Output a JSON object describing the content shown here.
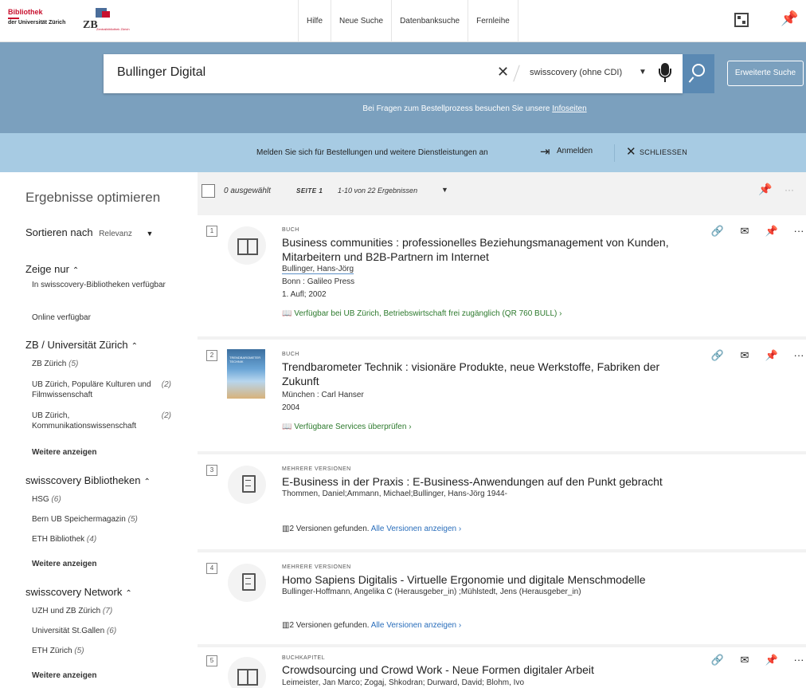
{
  "header": {
    "logo1_line1": "Bibliothek",
    "logo1_line2": "der Universität Zürich",
    "logo2_text": "ZB",
    "logo2_small": "Zentralbibliothek Zürich",
    "nav": [
      "Hilfe",
      "Neue Suche",
      "Datenbanksuche",
      "Fernleihe"
    ]
  },
  "search": {
    "query": "Bullinger Digital",
    "scope": "swisscovery (ohne CDI)",
    "advanced_label": "Erweiterte Suche",
    "info_prefix": "Bei Fragen zum Bestellprozess besuchen Sie unsere",
    "info_link": "Infoseiten"
  },
  "login": {
    "message": "Melden Sie sich für Bestellungen und weitere Dienstleistungen an",
    "signin_label": "Anmelden",
    "close_label": "SCHLIESSEN"
  },
  "sidebar": {
    "title": "Ergebnisse optimieren",
    "sort_label": "Sortieren nach",
    "sort_value": "Relevanz",
    "show_only": {
      "heading": "Zeige nur",
      "items": [
        "In swisscovery-Bibliotheken verfügbar",
        "Online verfügbar"
      ]
    },
    "zb": {
      "heading": "ZB / Universität Zürich",
      "items": [
        {
          "label": "ZB Zürich",
          "count": "(5)"
        },
        {
          "label": "UB Zürich, Populäre Kulturen und Filmwissenschaft",
          "count": "(2)"
        },
        {
          "label": "UB Zürich, Kommunikationswissenschaft",
          "count": "(2)"
        }
      ],
      "more": "Weitere anzeigen"
    },
    "libs": {
      "heading": "swisscovery Bibliotheken",
      "items": [
        {
          "label": "HSG",
          "count": "(6)"
        },
        {
          "label": "Bern UB Speichermagazin",
          "count": "(5)"
        },
        {
          "label": "ETH Bibliothek",
          "count": "(4)"
        }
      ],
      "more": "Weitere anzeigen"
    },
    "network": {
      "heading": "swisscovery Network",
      "items": [
        {
          "label": "UZH und ZB Zürich",
          "count": "(7)"
        },
        {
          "label": "Universität St.Gallen",
          "count": "(6)"
        },
        {
          "label": "ETH Zürich",
          "count": "(5)"
        }
      ],
      "more": "Weitere anzeigen"
    }
  },
  "results_bar": {
    "selected": "0 ausgewählt",
    "page": "SEITE 1",
    "range": "1-10 von 22 Ergebnissen"
  },
  "results": [
    {
      "num": "1",
      "type": "BUCH",
      "title": "Business communities : professionelles Beziehungsmanagement von Kunden, Mitarbeitern und B2B-Partnern im Internet",
      "author": "Bullinger, Hans-Jörg",
      "publisher": "Bonn : Galileo Press",
      "edition": "1. Aufl; 2002",
      "avail": "Verfügbar bei UB Zürich, Betriebswirtschaft  frei zugänglich (QR 760 BULL)  ›"
    },
    {
      "num": "2",
      "type": "BUCH",
      "title": "Trendbarometer Technik : visionäre Produkte, neue Werkstoffe, Fabriken der Zukunft",
      "publisher": "München : Carl Hanser",
      "year": "2004",
      "avail": "Verfügbare Services überprüfen  ›",
      "cover_text": "TRENDBAROMETER TECHNIK"
    },
    {
      "num": "3",
      "type": "MEHRERE VERSIONEN",
      "title": "E-Business in der Praxis : E-Business-Anwendungen auf den Punkt gebracht",
      "author": "Thommen, Daniel;Ammann, Michael;Bullinger, Hans-Jörg 1944-",
      "versions": "2 Versionen gefunden.",
      "versions_link": "Alle Versionen anzeigen  ›"
    },
    {
      "num": "4",
      "type": "MEHRERE VERSIONEN",
      "title": "Homo Sapiens Digitalis - Virtuelle Ergonomie und digitale Menschmodelle",
      "author": "Bullinger-Hoffmann, Angelika C (Herausgeber_in) ;Mühlstedt, Jens (Herausgeber_in)",
      "versions": "2 Versionen gefunden.",
      "versions_link": "Alle Versionen anzeigen  ›"
    },
    {
      "num": "5",
      "type": "BUCHKAPITEL",
      "title": "Crowdsourcing und Crowd Work - Neue Formen digitaler Arbeit",
      "author": "Leimeister, Jan Marco; Zogaj, Shkodran; Durward, David; Blohm, Ivo"
    }
  ]
}
